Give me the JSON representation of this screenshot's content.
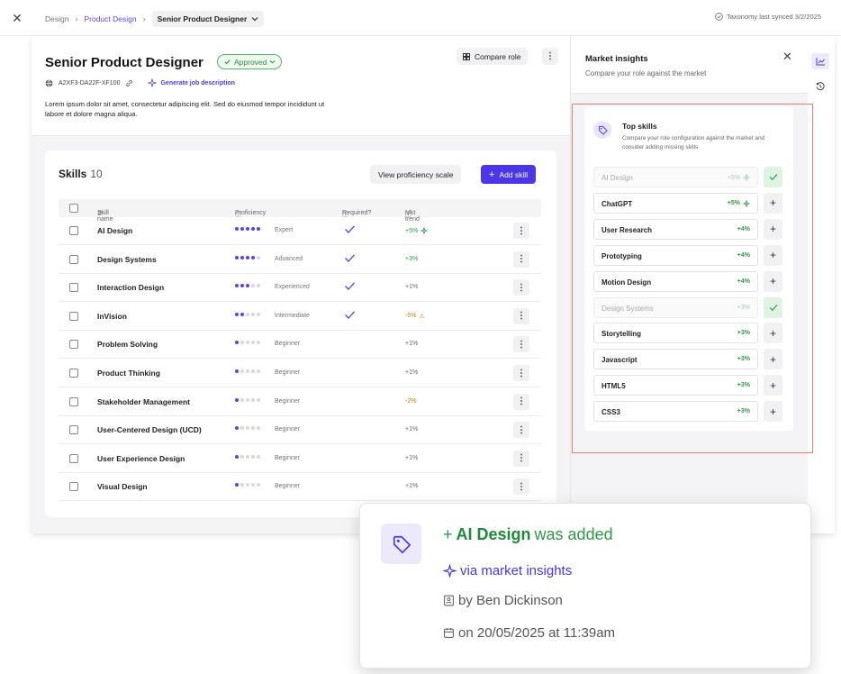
{
  "breadcrumb": {
    "items": [
      "Design",
      "Product Design"
    ],
    "current": "Senior Product Designer"
  },
  "sync_text": "Taxonomy last synced 3/2/2025",
  "role": {
    "title": "Senior Product Designer",
    "status": "Approved",
    "id": "A2XF3-DA22F-XF100",
    "generate_label": "Generate job description",
    "description": "Lorem ipsum dolor sit amet, consectetur adipiscing elit. Sed do eiusmod tempor incididunt ut labore et dolore magna aliqua.",
    "compare_label": "Compare role"
  },
  "skills": {
    "title": "Skills",
    "count": "10",
    "scale_label": "View proficiency scale",
    "add_label": "Add skill",
    "columns": {
      "name": "Skill name",
      "proficiency": "Proficiency",
      "required": "Required?",
      "trend": "Mkt trend"
    },
    "rows": [
      {
        "name": "AI Design",
        "level": 5,
        "level_label": "Expert",
        "required": true,
        "trend": "+5%",
        "trend_kind": "pos",
        "sparkle": true,
        "warn": false
      },
      {
        "name": "Design Systems",
        "level": 4,
        "level_label": "Advanced",
        "required": true,
        "trend": "+3%",
        "trend_kind": "pos",
        "sparkle": false,
        "warn": false
      },
      {
        "name": "Interaction Design",
        "level": 3,
        "level_label": "Experienced",
        "required": true,
        "trend": "+1%",
        "trend_kind": "neu",
        "sparkle": false,
        "warn": false
      },
      {
        "name": "InVision",
        "level": 2,
        "level_label": "Intermediate",
        "required": true,
        "trend": "-5%",
        "trend_kind": "neg",
        "sparkle": false,
        "warn": true
      },
      {
        "name": "Problem Solving",
        "level": 1,
        "level_label": "Beginner",
        "required": false,
        "trend": "+1%",
        "trend_kind": "neu",
        "sparkle": false,
        "warn": false
      },
      {
        "name": "Product Thinking",
        "level": 1,
        "level_label": "Beginner",
        "required": false,
        "trend": "+1%",
        "trend_kind": "neu",
        "sparkle": false,
        "warn": false
      },
      {
        "name": "Stakeholder Management",
        "level": 1,
        "level_label": "Beginner",
        "required": false,
        "trend": "-2%",
        "trend_kind": "neg",
        "sparkle": false,
        "warn": false
      },
      {
        "name": "User-Centered Design (UCD)",
        "level": 1,
        "level_label": "Beginner",
        "required": false,
        "trend": "+1%",
        "trend_kind": "neu",
        "sparkle": false,
        "warn": false
      },
      {
        "name": "User Experience Design",
        "level": 1,
        "level_label": "Beginner",
        "required": false,
        "trend": "+1%",
        "trend_kind": "neu",
        "sparkle": false,
        "warn": false
      },
      {
        "name": "Visual Design",
        "level": 1,
        "level_label": "Beginner",
        "required": false,
        "trend": "+1%",
        "trend_kind": "neu",
        "sparkle": false,
        "warn": false
      }
    ]
  },
  "insights": {
    "title": "Market insights",
    "subtitle": "Compare your role against the market",
    "top_skills_title": "Top skills",
    "top_skills_desc": "Compare your role configuration against the market and consider adding missing skills",
    "items": [
      {
        "name": "AI Design",
        "trend": "+5%",
        "added": true,
        "sparkle": true
      },
      {
        "name": "ChatGPT",
        "trend": "+5%",
        "added": false,
        "sparkle": true
      },
      {
        "name": "User Research",
        "trend": "+4%",
        "added": false,
        "sparkle": false
      },
      {
        "name": "Prototyping",
        "trend": "+4%",
        "added": false,
        "sparkle": false
      },
      {
        "name": "Motion Design",
        "trend": "+4%",
        "added": false,
        "sparkle": false
      },
      {
        "name": "Design Systems",
        "trend": "+3%",
        "added": true,
        "sparkle": false
      },
      {
        "name": "Storytelling",
        "trend": "+3%",
        "added": false,
        "sparkle": false
      },
      {
        "name": "Javascript",
        "trend": "+3%",
        "added": false,
        "sparkle": false
      },
      {
        "name": "HTML5",
        "trend": "+3%",
        "added": false,
        "sparkle": false
      },
      {
        "name": "CSS3",
        "trend": "+3%",
        "added": false,
        "sparkle": false
      }
    ]
  },
  "toast": {
    "prefix": "+",
    "skill": "AI Design",
    "suffix": "was added",
    "via": "via market insights",
    "by": "by Ben Dickinson",
    "on": "on 20/05/2025 at 11:39am"
  },
  "colors": {
    "accent": "#4b37e8",
    "positive": "#2e9a44",
    "warning": "#e07a10",
    "highlight_border": "#f07b6f"
  },
  "icons": [
    "close-icon",
    "chevron-right-icon",
    "chevron-down-icon",
    "sync-icon",
    "check-icon",
    "link-icon",
    "sparkle-icon",
    "grid-icon",
    "kebab-icon",
    "plus-icon",
    "sort-icon",
    "info-icon",
    "warning-icon",
    "tag-icon",
    "chart-icon",
    "history-icon",
    "id-card-icon",
    "calendar-icon"
  ]
}
